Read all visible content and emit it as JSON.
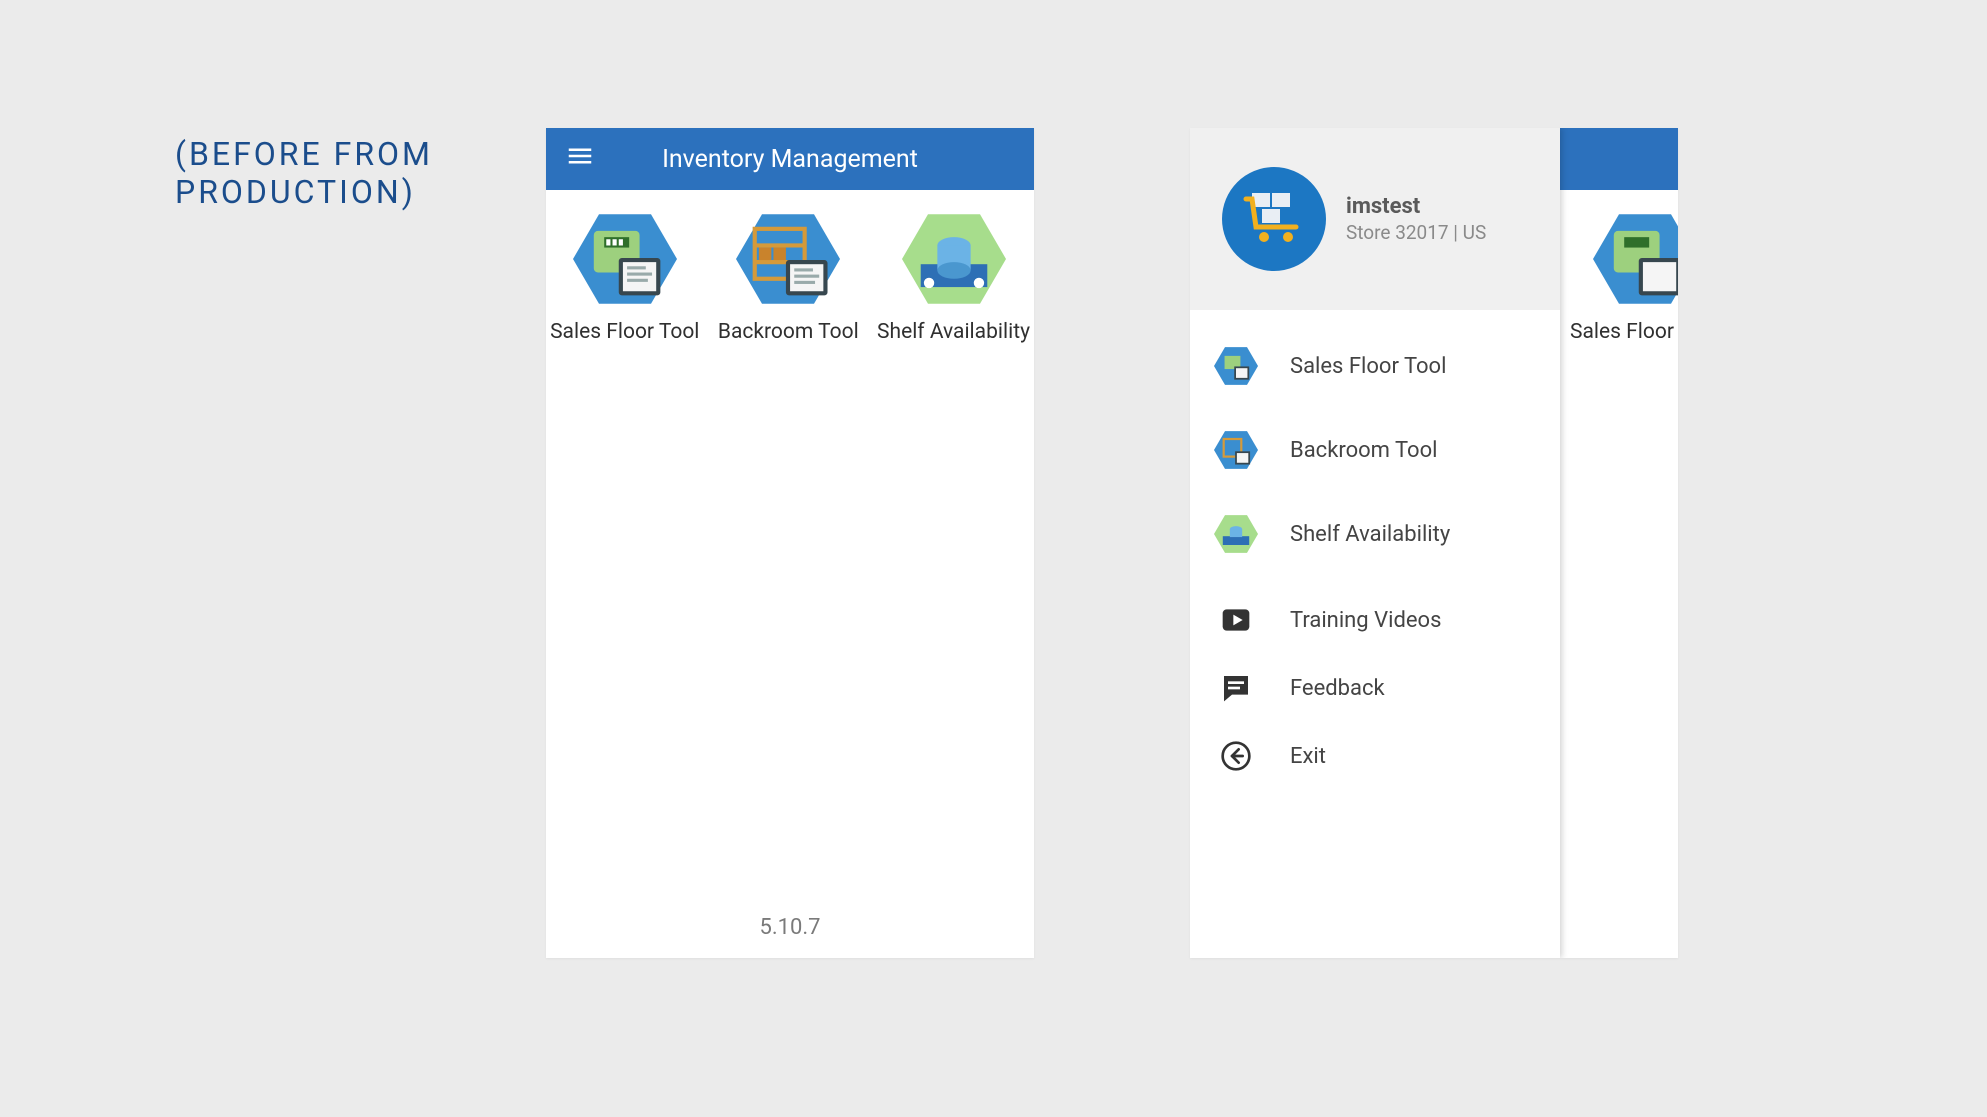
{
  "caption_line1": "(BEFORE  FROM",
  "caption_line2": "PRODUCTION)",
  "colors": {
    "appbar": "#2c71bd",
    "caption": "#1b4d8c"
  },
  "app": {
    "title": "Inventory Management",
    "version": "5.10.7",
    "home_items": [
      {
        "label": "Sales Floor Tool"
      },
      {
        "label": "Backroom Tool"
      },
      {
        "label": "Shelf Availability"
      }
    ]
  },
  "drawer": {
    "user": {
      "name": "imstest",
      "subtitle": "Store 32017 | US"
    },
    "items_primary": [
      {
        "label": "Sales Floor Tool"
      },
      {
        "label": "Backroom Tool"
      },
      {
        "label": "Shelf Availability"
      }
    ],
    "items_secondary": [
      {
        "label": "Training Videos",
        "icon": "play"
      },
      {
        "label": "Feedback",
        "icon": "chat"
      },
      {
        "label": "Exit",
        "icon": "back"
      }
    ]
  }
}
